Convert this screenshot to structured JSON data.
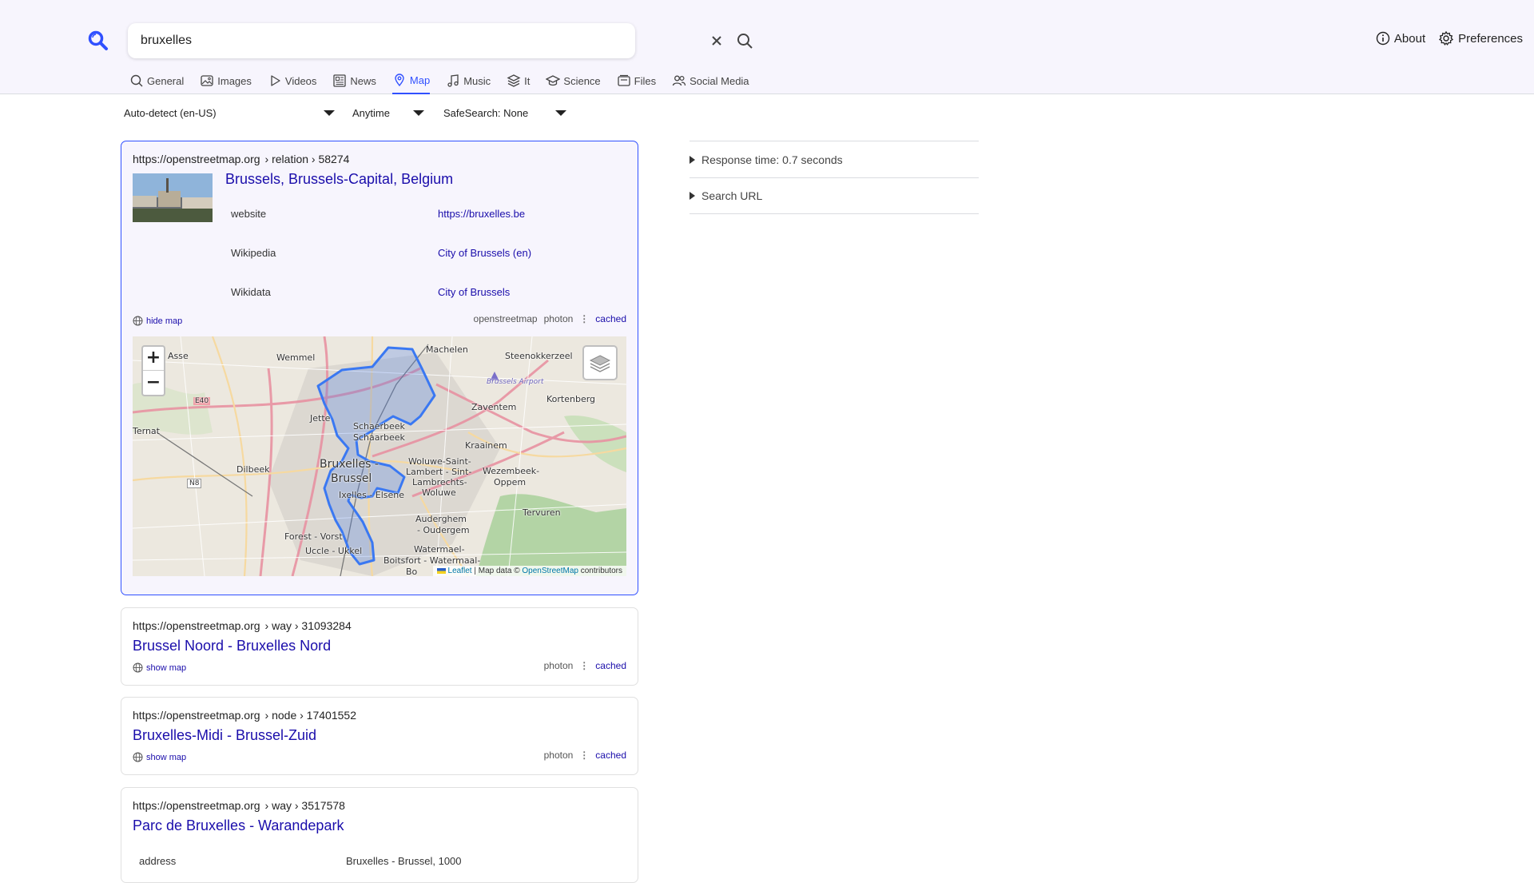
{
  "search": {
    "query": "bruxelles"
  },
  "top_links": [
    {
      "label": "About",
      "icon": "info-icon"
    },
    {
      "label": "Preferences",
      "icon": "gear-icon"
    }
  ],
  "tabs": [
    {
      "label": "General",
      "icon": "search-icon",
      "active": false
    },
    {
      "label": "Images",
      "icon": "image-icon",
      "active": false
    },
    {
      "label": "Videos",
      "icon": "play-icon",
      "active": false
    },
    {
      "label": "News",
      "icon": "newspaper-icon",
      "active": false
    },
    {
      "label": "Map",
      "icon": "map-pin-icon",
      "active": true
    },
    {
      "label": "Music",
      "icon": "music-note-icon",
      "active": false
    },
    {
      "label": "It",
      "icon": "layers-icon",
      "active": false
    },
    {
      "label": "Science",
      "icon": "graduation-cap-icon",
      "active": false
    },
    {
      "label": "Files",
      "icon": "file-box-icon",
      "active": false
    },
    {
      "label": "Social Media",
      "icon": "people-icon",
      "active": false
    }
  ],
  "filters": {
    "language": "Auto-detect (en-US)",
    "time": "Anytime",
    "safesearch": "SafeSearch: None"
  },
  "results": [
    {
      "domain": "https://openstreetmap.org",
      "path": "› relation › 58274",
      "title": "Brussels, Brussels-Capital, Belgium",
      "info": [
        {
          "key": "website",
          "value": "https://bruxelles.be"
        },
        {
          "key": "Wikipedia",
          "value": "City of Brussels (en)"
        },
        {
          "key": "Wikidata",
          "value": "City of Brussels"
        }
      ],
      "map_toggle": "hide map",
      "engines": [
        "openstreetmap",
        "photon"
      ],
      "cached": "cached"
    },
    {
      "domain": "https://openstreetmap.org",
      "path": "› way › 31093284",
      "title": "Brussel Noord - Bruxelles Nord",
      "map_toggle": "show map",
      "engines": [
        "photon"
      ],
      "cached": "cached"
    },
    {
      "domain": "https://openstreetmap.org",
      "path": "› node › 17401552",
      "title": "Bruxelles-Midi - Brussel-Zuid",
      "map_toggle": "show map",
      "engines": [
        "photon"
      ],
      "cached": "cached"
    },
    {
      "domain": "https://openstreetmap.org",
      "path": "› way › 3517578",
      "title": "Parc de Bruxelles - Warandepark",
      "info": [
        {
          "key": "address",
          "value": "Bruxelles - Brussel, 1000"
        }
      ]
    }
  ],
  "map": {
    "zoom_in": "+",
    "zoom_out": "−",
    "attribution_leaflet": "Leaflet",
    "attribution_text": "| Map data ©",
    "attribution_osm": "OpenStreetMap",
    "attribution_suffix": "contributors",
    "labels": [
      "Asse",
      "Wemmel",
      "Machelen",
      "Steenokkerzeel",
      "Brussels Airport",
      "Kortenberg",
      "Zaventem",
      "Ternat",
      "E40",
      "Jette",
      "Schaerbeek",
      "Schaarbeek",
      "Kraainem",
      "Dilbeek",
      "Bruxelles -",
      "Brussel",
      "Woluwe-Saint-",
      "Lambert - Sint-",
      "Lambrechts-",
      "Woluwe",
      "Wezembeek-",
      "Oppem",
      "N8",
      "Ixelles - Elsene",
      "Tervuren",
      "Auderghem",
      "- Oudergem",
      "Forest - Vorst",
      "Uccle - Ukkel",
      "Watermael-",
      "Boitsfort - Watermaal-",
      "Bo"
    ]
  },
  "sidebar": [
    {
      "label": "Response time: 0.7 seconds"
    },
    {
      "label": "Search URL"
    }
  ],
  "colors": {
    "accent": "#3050ff",
    "link": "#1a0dab",
    "header_bg": "#f7f5fd"
  }
}
